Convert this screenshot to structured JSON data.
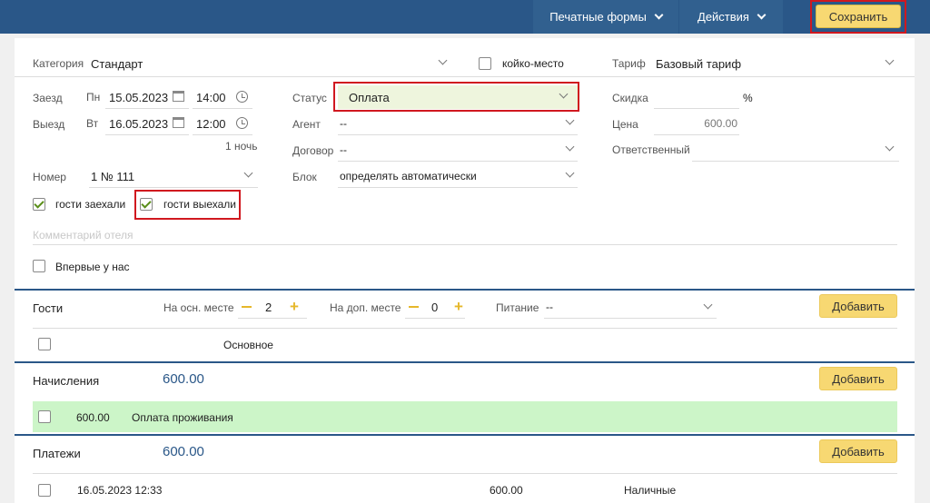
{
  "topbar": {
    "print_forms": "Печатные формы",
    "actions": "Действия",
    "save": "Сохранить"
  },
  "booking": {
    "category_label": "Категория",
    "category_value": "Стандарт",
    "bed_place_label": "койко-место",
    "tariff_label": "Тариф",
    "tariff_value": "Базовый тариф",
    "checkin_label": "Заезд",
    "checkin_day": "Пн",
    "checkin_date": "15.05.2023",
    "checkin_time": "14:00",
    "checkout_label": "Выезд",
    "checkout_day": "Вт",
    "checkout_date": "16.05.2023",
    "checkout_time": "12:00",
    "nights": "1 ночь",
    "status_label": "Статус",
    "status_value": "Оплата",
    "agent_label": "Агент",
    "agent_value": "--",
    "contract_label": "Договор",
    "contract_value": "--",
    "block_label": "Блок",
    "block_value": "определять автоматически",
    "discount_label": "Скидка",
    "discount_unit": "%",
    "price_label": "Цена",
    "price_value": "600.00",
    "responsible_label": "Ответственный",
    "room_label": "Номер",
    "room_value": "1 № 111",
    "guests_checked_in": "гости заехали",
    "guests_checked_out": "гости выехали",
    "comment_placeholder": "Комментарий отеля",
    "first_time": "Впервые у нас"
  },
  "guests": {
    "title": "Гости",
    "main_place_label": "На осн. месте",
    "main_place_count": "2",
    "extra_place_label": "На доп. месте",
    "extra_place_count": "0",
    "meal_label": "Питание",
    "meal_value": "--",
    "add": "Добавить",
    "row_main": "Основное"
  },
  "charges": {
    "title": "Начисления",
    "total": "600.00",
    "add": "Добавить",
    "rows": [
      {
        "amount": "600.00",
        "description": "Оплата проживания"
      }
    ]
  },
  "payments": {
    "title": "Платежи",
    "total": "600.00",
    "add": "Добавить",
    "rows": [
      {
        "datetime": "16.05.2023 12:33",
        "amount": "600.00",
        "method": "Наличные"
      }
    ]
  },
  "colors": {
    "topbar": "#2a5788",
    "accent_button": "#f7d872",
    "highlight": "#d0181f",
    "charge_row": "#ccf5c8"
  }
}
